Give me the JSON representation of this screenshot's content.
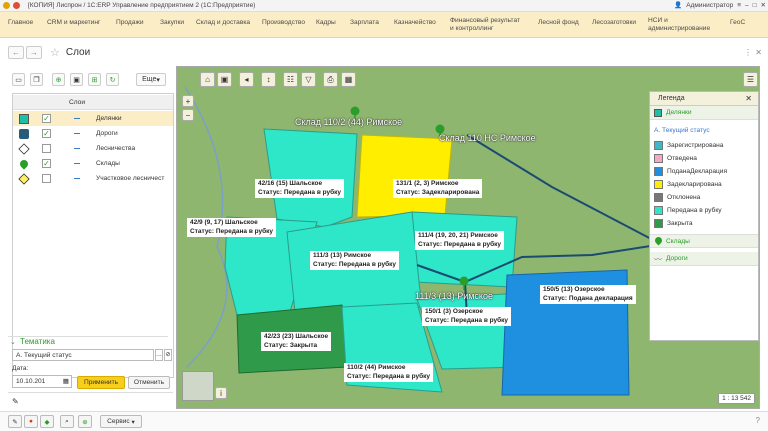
{
  "titlebar": {
    "text": "[КОПИЯ] Лиспрон / 1С:ERP Управление предприятием 2   (1С:Предприятие)",
    "user": "Администратор"
  },
  "menu": [
    "Главное",
    "CRM и маркетинг",
    "Продажи",
    "Закупки",
    "Склад и доставка",
    "Производство",
    "Кадры",
    "Зарплата",
    "Казначейство",
    "Финансовый результат и контроллинг",
    "Лесной фонд",
    "Лесозаготовки",
    "НСИ и администрирование",
    "ГеоС"
  ],
  "page": {
    "title": "Слои"
  },
  "layers": {
    "more": "Еще",
    "header": "Слои",
    "rows": [
      {
        "label": "Делянки",
        "checked": true
      },
      {
        "label": "Дороги",
        "checked": true
      },
      {
        "label": "Лесничества",
        "checked": false
      },
      {
        "label": "Склады",
        "checked": true
      },
      {
        "label": "Участковое лесничест",
        "checked": false
      }
    ]
  },
  "thematic": {
    "title": "Тематика",
    "value": "А. Текущий статус",
    "date_label": "Дата:",
    "date": "10.10.201",
    "apply": "Применить",
    "cancel": "Отменить"
  },
  "bottom": {
    "service": "Сервис"
  },
  "map": {
    "scale": "1 : 13 542",
    "warehouses": [
      "Склад 110/2 (44) Римское",
      "Склад 110 НС Римское"
    ],
    "big_label": "111/3 (13) Римское",
    "plots": [
      {
        "name": "42/16 (15) Шальское",
        "status": "Статус: Передана в рубку"
      },
      {
        "name": "131/1 (2, 3) Римское",
        "status": "Статус: Задекларирована"
      },
      {
        "name": "42/9 (9, 17) Шальское",
        "status": "Статус: Передана в рубку"
      },
      {
        "name": "111/4 (19, 20, 21) Римское",
        "status": "Статус: Передана в рубку"
      },
      {
        "name": "111/3 (13) Римское",
        "status": "Статус: Передана в рубку"
      },
      {
        "name": "150/5 (13) Озерское",
        "status": "Статус: Подана декларация"
      },
      {
        "name": "150/1 (3) Озерское",
        "status": "Статус: Передана в рубку"
      },
      {
        "name": "42/23 (23) Шальское",
        "status": "Статус: Закрыта"
      },
      {
        "name": "110/2 (44) Римское",
        "status": "Статус: Передана в рубку"
      }
    ]
  },
  "legend": {
    "title": "Легенда",
    "layer1": "Делянки",
    "subtitle": "А. Текущий статус",
    "items": [
      {
        "label": "Зарегистрирована",
        "color": "#3fb8c7"
      },
      {
        "label": "Отведена",
        "color": "#f4a9c4"
      },
      {
        "label": "ПоданаДекларация",
        "color": "#1f8fe0"
      },
      {
        "label": "Задекларирована",
        "color": "#ffee00"
      },
      {
        "label": "Отклонена",
        "color": "#777777"
      },
      {
        "label": "Передана в рубку",
        "color": "#2ee6c8"
      },
      {
        "label": "Закрыта",
        "color": "#2f9a4a"
      }
    ],
    "layer2": "Склады",
    "layer3": "Дороги"
  }
}
